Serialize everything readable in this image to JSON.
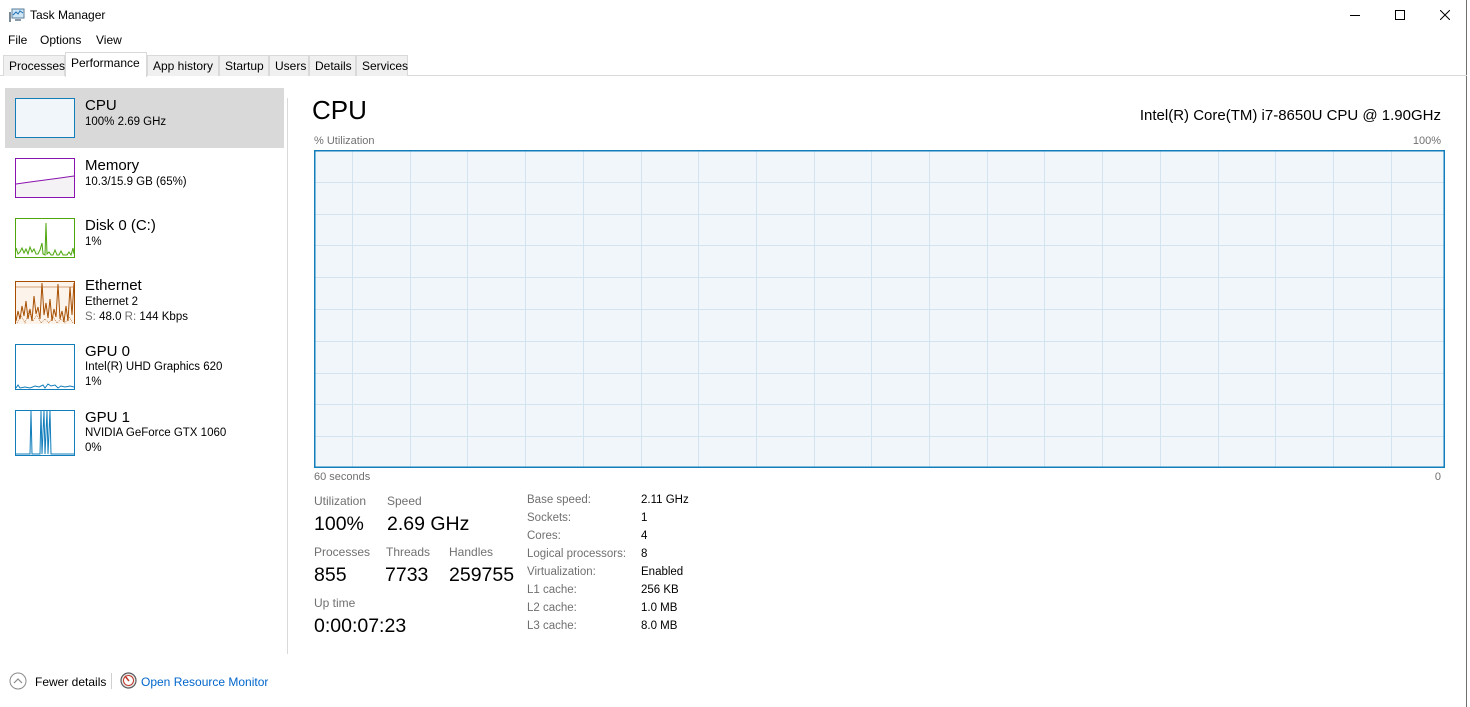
{
  "window": {
    "title": "Task Manager",
    "controls": {
      "minimize": "minimize",
      "maximize": "maximize",
      "close": "close"
    }
  },
  "menu": [
    "File",
    "Options",
    "View"
  ],
  "tabs": [
    {
      "label": "Processes",
      "active": false
    },
    {
      "label": "Performance",
      "active": true
    },
    {
      "label": "App history",
      "active": false
    },
    {
      "label": "Startup",
      "active": false
    },
    {
      "label": "Users",
      "active": false
    },
    {
      "label": "Details",
      "active": false
    },
    {
      "label": "Services",
      "active": false
    }
  ],
  "sidebar": {
    "items": [
      {
        "title": "CPU",
        "line1": "100%  2.69 GHz",
        "line2": "",
        "selected": true,
        "color": "#117dbb",
        "fill": "#f1f6fa",
        "load_percent": 100
      },
      {
        "title": "Memory",
        "line1": "10.3/15.9 GB (65%)",
        "line2": "",
        "selected": false,
        "color": "#8b12ae",
        "fill": "#f4f2f4",
        "load_percent": 65
      },
      {
        "title": "Disk 0 (C:)",
        "line1": "1%",
        "line2": "",
        "selected": false,
        "color": "#4da60c",
        "fill": "#effaeb",
        "load_percent": 1
      },
      {
        "title": "Ethernet",
        "line1": "Ethernet 2",
        "line2_send_label": "S:",
        "line2_send": "48.0",
        "line2_recv_label": "R:",
        "line2_recv": "144 Kbps",
        "selected": false,
        "color": "#a74f01",
        "fill": "#fcf3eb"
      },
      {
        "title": "GPU 0",
        "line1": "Intel(R) UHD Graphics 620",
        "line2": "1%",
        "selected": false,
        "color": "#117dbb",
        "fill": "#ffffff",
        "load_percent": 1
      },
      {
        "title": "GPU 1",
        "line1": "NVIDIA GeForce GTX 1060",
        "line2": "0%",
        "selected": false,
        "color": "#117dbb",
        "fill": "#ffffff",
        "load_percent": 0
      }
    ]
  },
  "main": {
    "title": "CPU",
    "model": "Intel(R) Core(TM) i7-8650U CPU @ 1.90GHz",
    "graph": {
      "y_label": "% Utilization",
      "y_max_label": "100%",
      "x_label": "60 seconds",
      "x_min_label": "0",
      "line_color": "#117dbb",
      "grid_color": "#d2e4f0",
      "fill_color": "#f1f6fa",
      "utilization_percent": 100
    },
    "stats": {
      "utilization": {
        "label": "Utilization",
        "value": "100%"
      },
      "speed": {
        "label": "Speed",
        "value": "2.69 GHz"
      },
      "processes": {
        "label": "Processes",
        "value": "855"
      },
      "threads": {
        "label": "Threads",
        "value": "7733"
      },
      "handles": {
        "label": "Handles",
        "value": "259755"
      },
      "uptime": {
        "label": "Up time",
        "value": "0:00:07:23"
      }
    },
    "info": [
      {
        "label": "Base speed:",
        "value": "2.11 GHz"
      },
      {
        "label": "Sockets:",
        "value": "1"
      },
      {
        "label": "Cores:",
        "value": "4"
      },
      {
        "label": "Logical processors:",
        "value": "8"
      },
      {
        "label": "Virtualization:",
        "value": "Enabled"
      },
      {
        "label": "L1 cache:",
        "value": "256 KB"
      },
      {
        "label": "L2 cache:",
        "value": "1.0 MB"
      },
      {
        "label": "L3 cache:",
        "value": "8.0 MB"
      }
    ]
  },
  "footer": {
    "fewer_details": "Fewer details",
    "resource_monitor": "Open Resource Monitor",
    "link_color": "#0066cc"
  }
}
